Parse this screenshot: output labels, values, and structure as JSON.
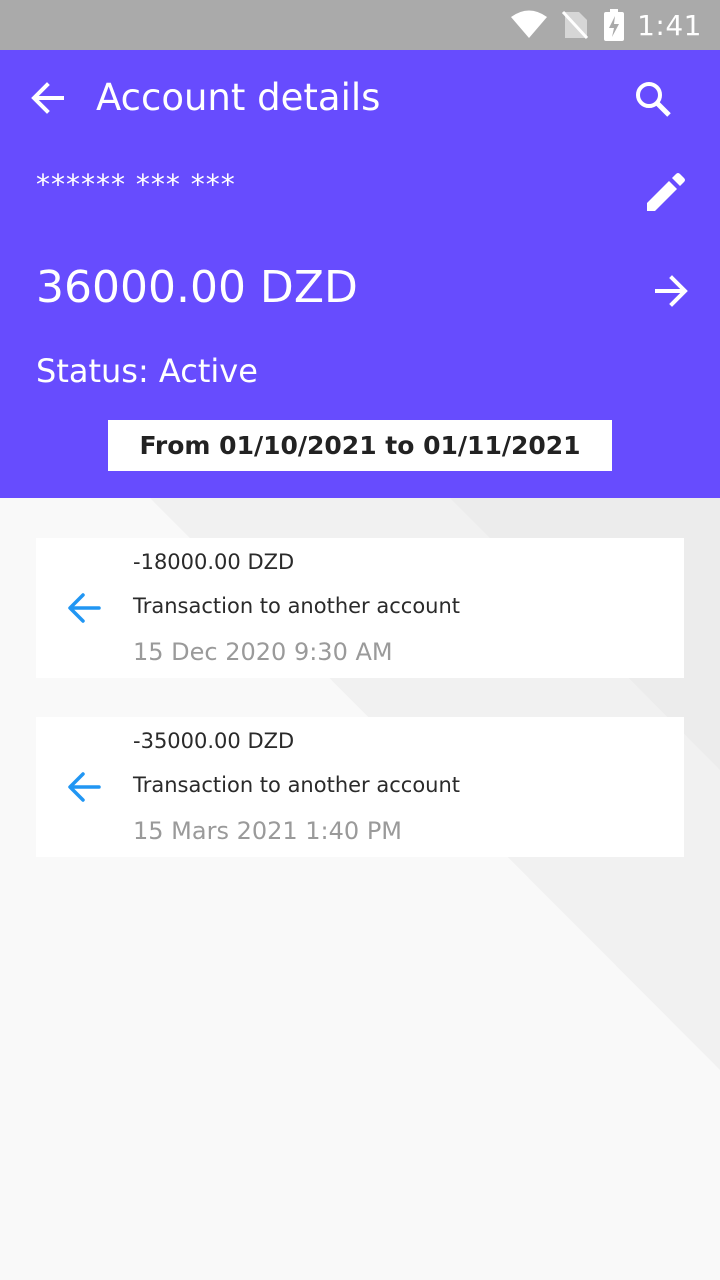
{
  "status_bar": {
    "time": "1:41",
    "icons": [
      "wifi-icon",
      "no-sim-icon",
      "battery-charging-icon"
    ]
  },
  "header": {
    "title": "Account details",
    "back_icon": "arrow-back-icon",
    "search_icon": "search-icon",
    "edit_icon": "pencil-icon",
    "forward_icon": "arrow-forward-icon",
    "account_number": "****** *** ***",
    "balance": "36000.00 DZD",
    "status": "Status: Active",
    "date_range": "From 01/10/2021 to 01/11/2021",
    "background_color": "#674cfe"
  },
  "transactions": [
    {
      "amount": "-18000.00 DZD",
      "description": "Transaction to another account",
      "date": "15 Dec 2020 9:30 AM",
      "icon": "arrow-left-icon"
    },
    {
      "amount": "-35000.00 DZD",
      "description": "Transaction to another account",
      "date": "15 Mars 2021 1:40 PM",
      "icon": "arrow-left-icon"
    }
  ],
  "colors": {
    "accent": "#674cfe",
    "transaction_icon": "#2196f3",
    "muted_text": "#9a9a9a"
  }
}
